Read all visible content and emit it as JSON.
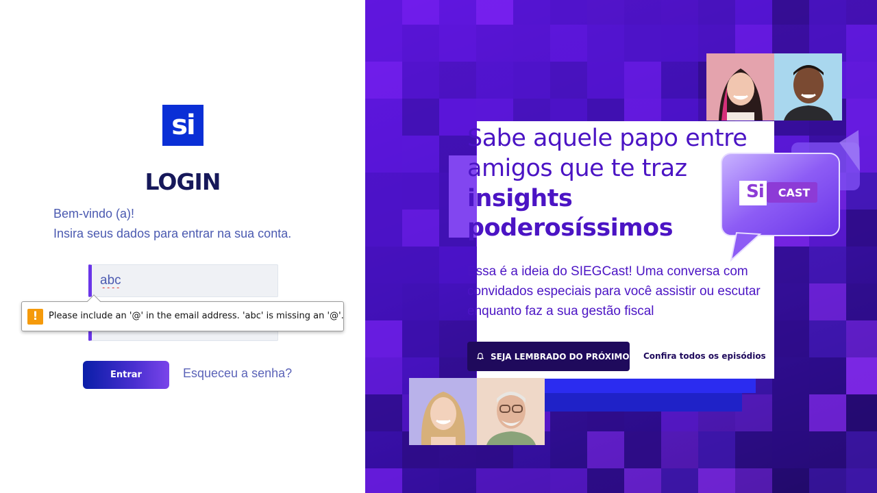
{
  "login": {
    "logo": "si",
    "title": "LOGIN",
    "welcome_line1": "Bem-vindo (a)!",
    "welcome_line2": "Insira seus dados para entrar na sua conta.",
    "email_value": "abc",
    "validation_message": "Please include an '@' in the email address. 'abc' is missing an '@'.",
    "validation_icon": "warning-icon",
    "enter_label": "Entrar",
    "forgot_label": "Esqueceu a senha?"
  },
  "promo": {
    "headline_line1": "Sabe aquele papo entre",
    "headline_line2": "amigos que te traz",
    "headline_line3": "insights",
    "headline_line4": "poderosíssimos",
    "body_line1": "Essa é a ideia do SIEGCast! Uma conversa com",
    "body_line2": "convidados especiais para você assistir ou escutar",
    "body_line3": "enquanto faz a sua gestão fiscal",
    "remind_label": "SEJA LEMBRADO DO PRÓXIMO",
    "remind_icon": "bell-icon",
    "episodes_label": "Confira todos os episódios",
    "badge_si": "Si",
    "badge_cast": "CAST"
  },
  "colors": {
    "brand_blue": "#0a2fd6",
    "title_navy": "#16185a",
    "accent_purple": "#4b14c4",
    "dark_button": "#1f0a5c"
  }
}
